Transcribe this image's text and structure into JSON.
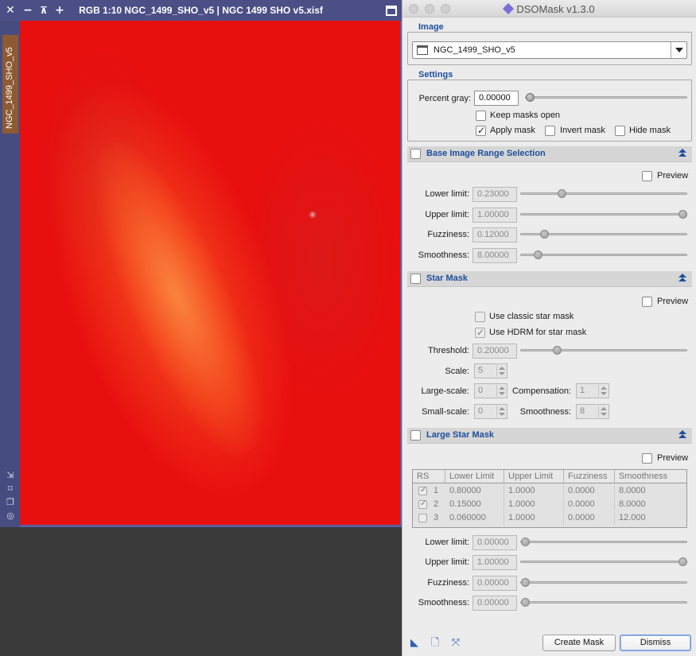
{
  "image_window": {
    "title": "RGB 1:10 NGC_1499_SHO_v5 | NGC 1499 SHO v5.xisf",
    "side_tab": "NGC_1499_SHO_v5",
    "controls": [
      "close-icon",
      "minimize-icon",
      "shade-icon",
      "maximize-icon"
    ]
  },
  "dialog": {
    "title": "DSOMask v1.3.0",
    "image_group": {
      "label": "Image",
      "selected": "NGC_1499_SHO_v5"
    },
    "settings": {
      "label": "Settings",
      "percent_gray_label": "Percent gray:",
      "percent_gray_value": "0.00000",
      "percent_gray_level": 0.0,
      "keep_masks_open": "Keep masks open",
      "keep_masks_open_checked": false,
      "apply_mask": "Apply mask",
      "apply_mask_checked": true,
      "invert_mask": "Invert mask",
      "invert_mask_checked": false,
      "hide_mask": "Hide mask",
      "hide_mask_checked": false
    },
    "base_range": {
      "title": "Base Image Range Selection",
      "preview": "Preview",
      "rows": [
        {
          "label": "Lower limit:",
          "value": "0.23000",
          "level": 0.23
        },
        {
          "label": "Upper limit:",
          "value": "1.00000",
          "level": 1.0
        },
        {
          "label": "Fuzziness:",
          "value": "0.12000",
          "level": 0.12
        },
        {
          "label": "Smoothness:",
          "value": "8.00000",
          "level": 0.08
        }
      ]
    },
    "star_mask": {
      "title": "Star Mask",
      "preview": "Preview",
      "use_classic": "Use classic star mask",
      "use_classic_checked": false,
      "use_hdrm": "Use HDRM for star mask",
      "use_hdrm_checked": true,
      "threshold_label": "Threshold:",
      "threshold_value": "0.20000",
      "threshold_level": 0.2,
      "scale_label": "Scale:",
      "scale_value": "5",
      "large_scale_label": "Large-scale:",
      "large_scale_value": "0",
      "compensation_label": "Compensation:",
      "compensation_value": "1",
      "small_scale_label": "Small-scale:",
      "small_scale_value": "0",
      "smoothness_label": "Smoothness:",
      "smoothness_value": "8"
    },
    "large_star_mask": {
      "title": "Large Star Mask",
      "preview": "Preview",
      "columns": [
        "RS",
        "Lower Limit",
        "Upper Limit",
        "Fuzziness",
        "Smoothness"
      ],
      "rows": [
        {
          "checked": true,
          "rs": "1",
          "lower": "0.80000",
          "upper": "1.0000",
          "fuzz": "0.0000",
          "smooth": "8.0000"
        },
        {
          "checked": true,
          "rs": "2",
          "lower": "0.15000",
          "upper": "1.0000",
          "fuzz": "0.0000",
          "smooth": "8.0000"
        },
        {
          "checked": false,
          "rs": "3",
          "lower": "0.060000",
          "upper": "1.0000",
          "fuzz": "0.0000",
          "smooth": "12.000"
        }
      ],
      "sliders": [
        {
          "label": "Lower limit:",
          "value": "0.00000",
          "level": 0.0
        },
        {
          "label": "Upper limit:",
          "value": "1.00000",
          "level": 1.0
        },
        {
          "label": "Fuzziness:",
          "value": "0.00000",
          "level": 0.0
        },
        {
          "label": "Smoothness:",
          "value": "0.00000",
          "level": 0.0
        }
      ]
    },
    "buttons": {
      "create": "Create Mask",
      "dismiss": "Dismiss"
    },
    "footer_icons": [
      "new-instance-icon",
      "browse-documentation-icon",
      "reset-icon"
    ]
  },
  "colors": {
    "accent": "#1c4f9c",
    "image_frame": "#4b4f86",
    "mask_red": "#e80f0f"
  }
}
